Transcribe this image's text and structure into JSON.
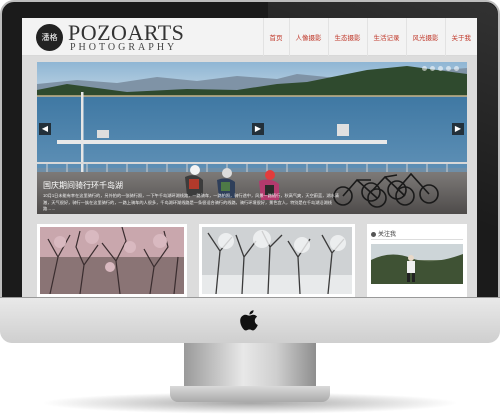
{
  "header": {
    "logo_mark": "潘格",
    "logo_title": "POZOARTS",
    "logo_subtitle": "PHOTOGRAPHY"
  },
  "nav": {
    "items": [
      {
        "label": "首页"
      },
      {
        "label": "人像摄影"
      },
      {
        "label": "生态摄影"
      },
      {
        "label": "生活记录"
      },
      {
        "label": "风光摄影"
      },
      {
        "label": "关于我"
      }
    ]
  },
  "slider": {
    "caption_title": "国庆期间骑行环千岛湖",
    "caption_text": "10月1日未能有幸在这里骑行的，另外拍的一张骑行照，一下午千岛湖环湖线路，一路骑车，一路拍照，骑行途中，风景一路随行，秋高气爽，天空蔚蓝，湖水清澈，天气很好，骑行一族在这里骑行的，一路上骑车的人很多，千岛湖环湖线路是一条很适合骑行的线路，骑行环境很好，景色宜人，特别是在千岛湖沿湖线路……",
    "slides": 5,
    "prev_icon": "chevron-left-icon",
    "next_icon": "chevron-right-icon",
    "pause_icon": "play-icon"
  },
  "sidebar": {
    "heading": "关注我",
    "heading_icon": "user-icon"
  },
  "colors": {
    "nav_text": "#c0392b",
    "screen_bg": "#dcdcdc",
    "header_bg": "#f3f3f3",
    "bezel": "#1b1b1b"
  }
}
